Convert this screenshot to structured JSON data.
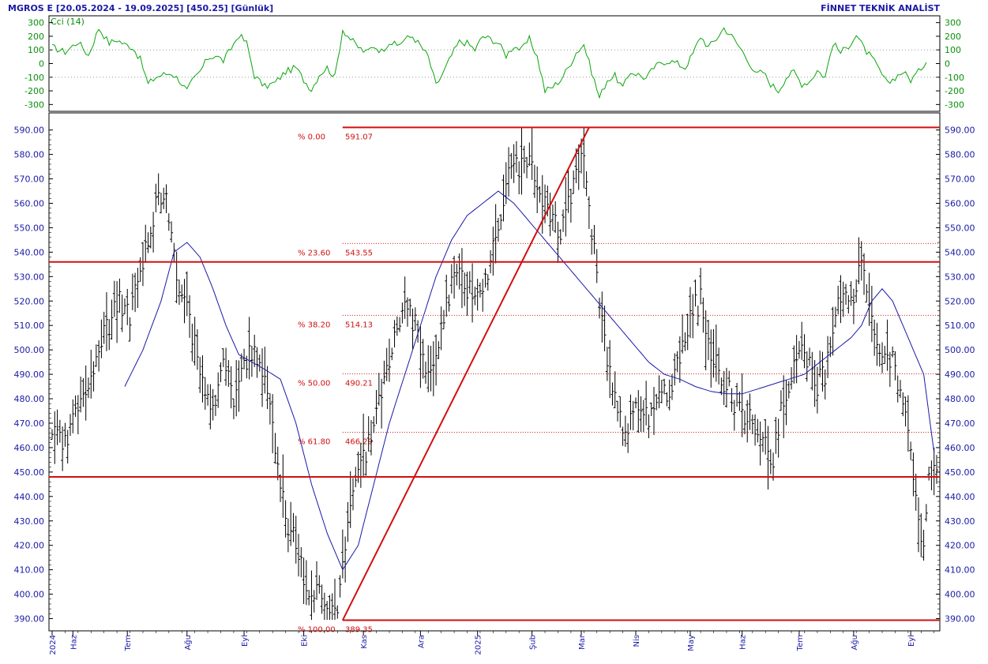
{
  "header": {
    "title": "MGROS E  [20.05.2024 - 19.09.2025]  [450.25]  [Günlük]",
    "brand": "FİNNET TEKNİK ANALİST"
  },
  "colors": {
    "price_bar": "#000000",
    "moving_average": "#1a1aa6",
    "cci": "#0aa50a",
    "fibonacci": "#d01010",
    "axis_text": "#1a1aa6",
    "cci_axis_text": "#0a8f0a"
  },
  "chart_data": [
    {
      "type": "line",
      "panel": "indicator",
      "title": "Cci (14)",
      "ylim": [
        -350,
        350
      ],
      "y_ticks": [
        300,
        200,
        100,
        0,
        -100,
        -200,
        -300
      ],
      "reference_lines": [
        100,
        -100
      ],
      "grid": "dotted",
      "series": [
        {
          "name": "Cci (14)",
          "x": [
            0,
            5,
            10,
            14,
            18,
            22,
            25,
            28,
            31,
            34,
            37,
            40,
            43,
            46,
            49,
            52,
            54,
            57,
            60,
            63,
            66,
            69,
            72,
            75,
            78,
            82,
            86,
            90,
            94,
            97,
            100,
            103,
            106,
            109,
            112,
            115,
            118,
            121,
            124,
            127,
            130,
            133,
            136,
            139,
            142,
            145,
            148,
            151,
            154,
            157,
            160,
            163,
            166,
            169,
            172,
            175,
            178,
            181,
            184,
            187,
            190,
            193,
            196,
            199,
            202,
            205,
            208,
            211,
            214,
            217,
            220,
            223,
            226,
            229,
            232,
            235,
            238,
            241,
            244,
            247,
            250,
            253,
            256,
            259,
            262,
            265,
            268,
            271,
            274,
            277,
            280,
            283,
            286,
            289,
            292,
            295,
            298,
            301,
            304,
            307,
            310,
            313,
            316,
            319,
            322,
            325,
            328,
            331,
            334,
            337
          ],
          "values": [
            120,
            85,
            160,
            60,
            260,
            150,
            175,
            140,
            120,
            30,
            -150,
            -100,
            -80,
            -70,
            -120,
            -200,
            -130,
            -60,
            40,
            60,
            20,
            110,
            210,
            150,
            -90,
            -170,
            -140,
            -60,
            -30,
            -120,
            -190,
            -80,
            -30,
            -100,
            250,
            180,
            120,
            80,
            130,
            90,
            160,
            130,
            180,
            200,
            130,
            50,
            -160,
            -60,
            60,
            160,
            150,
            100,
            200,
            180,
            150,
            60,
            130,
            100,
            180,
            50,
            -200,
            -170,
            -120,
            -30,
            80,
            140,
            -60,
            -250,
            -120,
            -90,
            -180,
            -60,
            -80,
            -110,
            -30,
            10,
            20,
            0,
            -30,
            70,
            200,
            120,
            180,
            260,
            200,
            120,
            40,
            -80,
            -60,
            -150,
            -200,
            -100,
            -60,
            -150,
            -130,
            -50,
            -100,
            150,
            80,
            130,
            210,
            110,
            40,
            -50,
            -150,
            -100,
            -60,
            -120,
            -60,
            20
          ]
        }
      ]
    },
    {
      "type": "bar",
      "subtype": "ohlc",
      "panel": "price",
      "ylim": [
        385,
        597
      ],
      "y_ticks": [
        590,
        580,
        570,
        560,
        550,
        540,
        530,
        520,
        510,
        500,
        490,
        480,
        470,
        460,
        450,
        440,
        430,
        420,
        410,
        400,
        390
      ],
      "x_range": [
        0,
        341
      ],
      "x_tick_labels": [
        "2024",
        "Haz",
        "Tem",
        "Ağu",
        "Eyl",
        "Eki",
        "Kas",
        "Ara",
        "2025",
        "Şub",
        "Mar",
        "Nis",
        "May",
        "Haz",
        "Tem",
        "Ağu",
        "Eyl"
      ],
      "x_tick_index": [
        0,
        8,
        29,
        52,
        74,
        97,
        120,
        142,
        164,
        185,
        204,
        225,
        246,
        266,
        288,
        309,
        331
      ],
      "horizontal_lines": [
        591.07,
        536,
        448,
        389.35
      ],
      "trend_line": {
        "from": [
          112,
          389.35
        ],
        "to": [
          207,
          591.07
        ]
      },
      "fibonacci": {
        "anchor_index": 112,
        "levels": [
          {
            "pct": "% 0.00",
            "value": "591.07",
            "y": 591.07
          },
          {
            "pct": "% 23.60",
            "value": "543.55",
            "y": 543.55
          },
          {
            "pct": "% 38.20",
            "value": "514.13",
            "y": 514.13
          },
          {
            "pct": "% 50.00",
            "value": "490.21",
            "y": 490.21
          },
          {
            "pct": "% 61.80",
            "value": "466.29",
            "y": 466.29
          },
          {
            "pct": "% 100.00",
            "value": "389.35",
            "y": 389.35
          }
        ]
      },
      "series": [
        {
          "name": "",
          "x": [
            0,
            5,
            10,
            15,
            20,
            25,
            30,
            35,
            40,
            43,
            45,
            48,
            51,
            54,
            58,
            62,
            66,
            70,
            74,
            78,
            82,
            86,
            90,
            94,
            98,
            102,
            106,
            110,
            113,
            116,
            120,
            124,
            128,
            132,
            136,
            140,
            144,
            148,
            152,
            156,
            160,
            164,
            168,
            172,
            176,
            180,
            184,
            187,
            190,
            193,
            196,
            199,
            202,
            205,
            207,
            209,
            211,
            213,
            215,
            218,
            221,
            224,
            227,
            230,
            234,
            238,
            242,
            246,
            250,
            254,
            258,
            262,
            266,
            270,
            274,
            278,
            282,
            286,
            290,
            294,
            298,
            302,
            306,
            310,
            312,
            316,
            320,
            324,
            327,
            330,
            332,
            334,
            336,
            338,
            340
          ],
          "values": [
            470,
            460,
            475,
            490,
            505,
            520,
            515,
            535,
            560,
            565,
            555,
            530,
            520,
            505,
            490,
            475,
            495,
            480,
            495,
            500,
            490,
            460,
            430,
            420,
            405,
            400,
            395,
            392,
            420,
            440,
            455,
            470,
            490,
            505,
            520,
            510,
            490,
            500,
            520,
            530,
            525,
            520,
            530,
            550,
            570,
            575,
            580,
            570,
            560,
            555,
            545,
            560,
            575,
            580,
            560,
            540,
            520,
            505,
            490,
            475,
            465,
            475,
            480,
            470,
            480,
            485,
            495,
            515,
            520,
            500,
            490,
            480,
            475,
            470,
            465,
            455,
            480,
            495,
            500,
            485,
            490,
            515,
            520,
            525,
            535,
            510,
            495,
            495,
            480,
            465,
            450,
            430,
            420,
            445,
            450
          ]
        },
        {
          "name": "",
          "x": [
            28,
            35,
            42,
            47,
            52,
            57,
            62,
            67,
            72,
            77,
            82,
            88,
            94,
            100,
            106,
            112,
            118,
            124,
            130,
            136,
            142,
            148,
            154,
            160,
            166,
            172,
            178,
            182,
            186,
            190,
            194,
            198,
            202,
            206,
            210,
            214,
            218,
            222,
            226,
            230,
            236,
            242,
            248,
            254,
            260,
            266,
            272,
            278,
            284,
            290,
            296,
            302,
            308,
            312,
            316,
            320,
            324,
            328,
            332,
            336,
            340
          ],
          "values": [
            485,
            500,
            520,
            540,
            544,
            538,
            525,
            510,
            498,
            495,
            492,
            488,
            470,
            445,
            425,
            410,
            420,
            445,
            470,
            490,
            510,
            530,
            545,
            555,
            560,
            565,
            560,
            555,
            550,
            545,
            540,
            535,
            530,
            525,
            520,
            515,
            510,
            505,
            500,
            495,
            490,
            488,
            485,
            483,
            482,
            482,
            484,
            486,
            488,
            490,
            495,
            500,
            505,
            510,
            520,
            525,
            520,
            510,
            500,
            490,
            458
          ]
        }
      ]
    }
  ]
}
